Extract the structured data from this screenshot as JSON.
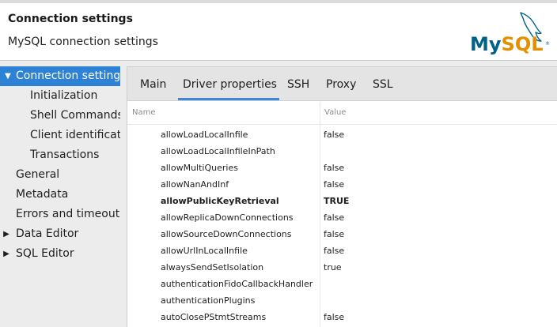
{
  "header": {
    "title": "Connection settings",
    "subtitle": "MySQL connection settings",
    "logo_text": "MySQL",
    "logo_colors": {
      "my": "#00618a",
      "sql": "#e48e00"
    }
  },
  "tree": [
    {
      "label": "Connection settings",
      "expander": "▼",
      "selected": true
    },
    {
      "label": "Initialization"
    },
    {
      "label": "Shell Commands"
    },
    {
      "label": "Client identification"
    },
    {
      "label": "Transactions"
    },
    {
      "label": "General"
    },
    {
      "label": "Metadata"
    },
    {
      "label": "Errors and timeouts"
    },
    {
      "label": "Data Editor",
      "expander": "▶"
    },
    {
      "label": "SQL Editor",
      "expander": "▶"
    }
  ],
  "tabs": [
    {
      "label": "Main"
    },
    {
      "label": "Driver properties",
      "active": true
    },
    {
      "label": "SSH"
    },
    {
      "label": "Proxy"
    },
    {
      "label": "SSL"
    }
  ],
  "table": {
    "columns": [
      "Name",
      "Value"
    ],
    "rows": [
      {
        "name": "allowLoadLocalInfile",
        "value": "false"
      },
      {
        "name": "allowLoadLocalInfileInPath",
        "value": ""
      },
      {
        "name": "allowMultiQueries",
        "value": "false"
      },
      {
        "name": "allowNanAndInf",
        "value": "false"
      },
      {
        "name": "allowPublicKeyRetrieval",
        "value": "TRUE",
        "bold": true
      },
      {
        "name": "allowReplicaDownConnections",
        "value": "false"
      },
      {
        "name": "allowSourceDownConnections",
        "value": "false"
      },
      {
        "name": "allowUrlInLocalInfile",
        "value": "false"
      },
      {
        "name": "alwaysSendSetIsolation",
        "value": "true"
      },
      {
        "name": "authenticationFidoCallbackHandler",
        "value": ""
      },
      {
        "name": "authenticationPlugins",
        "value": ""
      },
      {
        "name": "autoClosePStmtStreams",
        "value": "false"
      }
    ]
  },
  "colors": {
    "selection": "#2d82d6",
    "tab_underline": "#3f87d6"
  }
}
